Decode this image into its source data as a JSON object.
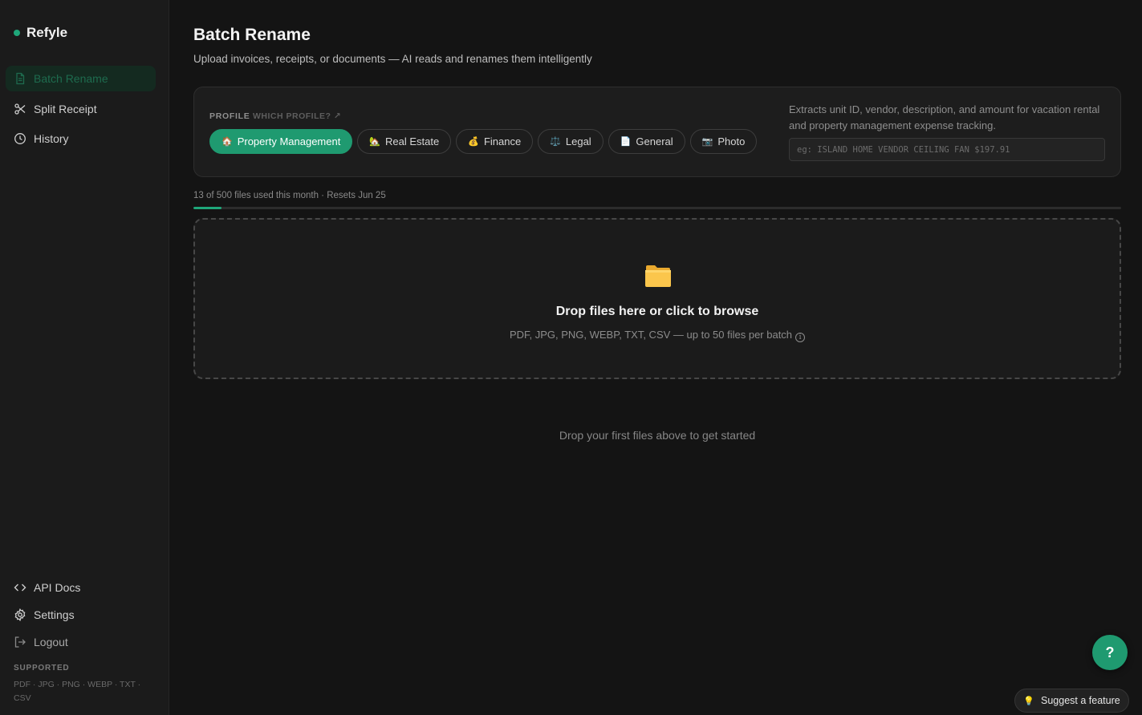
{
  "brand": {
    "name": "Refyle",
    "dot_color": "#1fa77a"
  },
  "sidebar": {
    "nav": [
      {
        "label": "Batch Rename",
        "icon": "document-icon",
        "active": true
      },
      {
        "label": "Split Receipt",
        "icon": "scissors-icon",
        "active": false
      },
      {
        "label": "History",
        "icon": "clock-icon",
        "active": false
      }
    ],
    "bottom": [
      {
        "label": "API Docs",
        "icon": "code-icon"
      },
      {
        "label": "Settings",
        "icon": "gear-icon"
      },
      {
        "label": "Logout",
        "icon": "logout-icon"
      }
    ],
    "supported_title": "SUPPORTED",
    "supported_list": "PDF · JPG · PNG · WEBP · TXT · CSV"
  },
  "page": {
    "title": "Batch Rename",
    "subtitle": "Upload invoices, receipts, or documents — AI reads and renames them intelligently"
  },
  "profile": {
    "label": "PROFILE",
    "which_link": "WHICH PROFILE? ↗",
    "chips": [
      {
        "emoji": "🏠",
        "label": "Property Management",
        "active": true
      },
      {
        "emoji": "🏡",
        "label": "Real Estate",
        "active": false
      },
      {
        "emoji": "💰",
        "label": "Finance",
        "active": false
      },
      {
        "emoji": "⚖️",
        "label": "Legal",
        "active": false
      },
      {
        "emoji": "📄",
        "label": "General",
        "active": false
      },
      {
        "emoji": "📷",
        "label": "Photo",
        "active": false
      }
    ],
    "description": "Extracts unit ID, vendor, description, and amount for vacation rental and property management expense tracking.",
    "example_placeholder": "eg: ISLAND HOME VENDOR CEILING FAN $197.91"
  },
  "usage": {
    "text": "13 of 500 files used this month · Resets Jun 25",
    "fraction": 0.03,
    "accent": "#1fa77a"
  },
  "dropzone": {
    "icon": "folder-icon",
    "title": "Drop files here or click to browse",
    "subtitle": "PDF, JPG, PNG, WEBP, TXT, CSV — up to 50 files per batch",
    "info_glyph": "i"
  },
  "empty_state": "Drop your first files above to get started",
  "help_button": "?",
  "suggest_button": {
    "emoji": "💡",
    "label": "Suggest a feature"
  }
}
